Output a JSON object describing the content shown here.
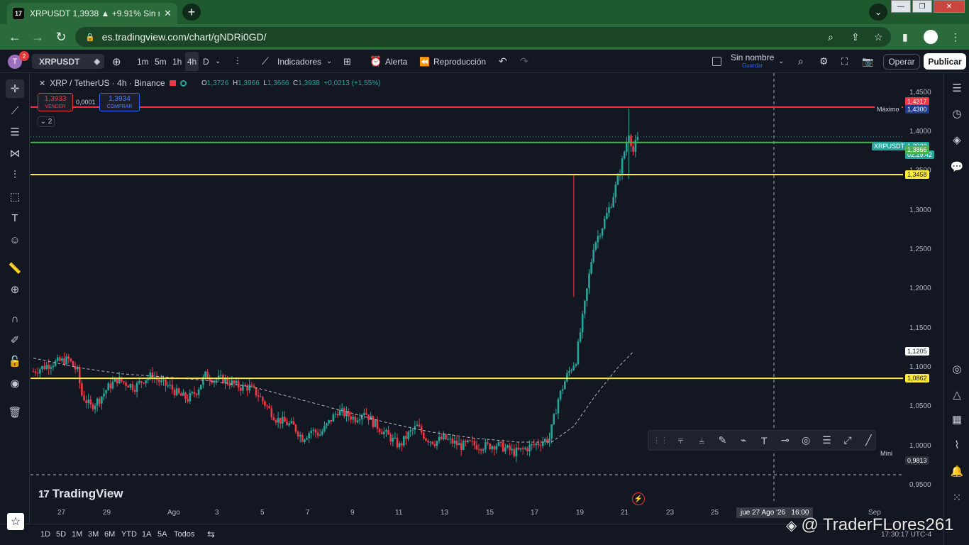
{
  "browser": {
    "tab_title": "XRPUSDT 1,3938 ▲ +9.91% Sin n",
    "tab_favicon": "17",
    "url": "es.tradingview.com/chart/gNDRi0GD/"
  },
  "toolbar": {
    "avatar_letter": "T",
    "notification_count": "2",
    "symbol": "XRPUSDT",
    "timeframes": [
      "1m",
      "5m",
      "1h",
      "4h",
      "D"
    ],
    "active_timeframe": "4h",
    "indicators_label": "Indicadores",
    "alert_label": "Alerta",
    "replay_label": "Reproducción",
    "layout_name": "Sin nombre",
    "save_label": "Guardar",
    "trade_label": "Operar",
    "publish_label": "Publicar"
  },
  "legend": {
    "title": "XRP / TetherUS · 4h · Binance",
    "o_label": "O",
    "o": "1,3726",
    "h_label": "H",
    "h": "1,3966",
    "l_label": "L",
    "l": "1,3666",
    "c_label": "C",
    "c": "1,3938",
    "change": "+0,0213 (+1,55%)",
    "sell_price": "1,3933",
    "sell_label": "VENDER",
    "spread": "0,0001",
    "buy_price": "1,3934",
    "buy_label": "COMPRAR",
    "collapsed_count": "2"
  },
  "brand": {
    "logo_text": "TradingView",
    "watermark": "@ TraderFLores261"
  },
  "price_axis": {
    "ticks": [
      "1,4500",
      "1,4000",
      "1,3500",
      "1,3000",
      "1,2500",
      "1,2000",
      "1,1500",
      "1,1000",
      "1,0500",
      "1,0000",
      "0,9500"
    ],
    "badges": {
      "max_label": "Máximo",
      "max_value": "1,4300",
      "red_line": "1,4317",
      "symbol_label": "XRPUSDT",
      "last_price": "1,3938",
      "countdown": "02:29:42",
      "green_line": "1,3866",
      "yellow_top": "1,3458",
      "ma_value": "1,1205",
      "yellow_bottom": "1,0862",
      "min_label": "Míni",
      "min_value": "0,9813"
    }
  },
  "time_axis": {
    "ticks": [
      "27",
      "29",
      "Ago",
      "3",
      "5",
      "7",
      "9",
      "11",
      "13",
      "15",
      "17",
      "19",
      "21",
      "23",
      "25",
      "Sep"
    ],
    "crosshair_label": "jue 27 Ago '26   16:00"
  },
  "ranges": [
    "1D",
    "5D",
    "1M",
    "3M",
    "6M",
    "YTD",
    "1A",
    "5A",
    "Todos"
  ],
  "clock": "17:30:17 UTC-4",
  "chart_data": {
    "type": "candlestick",
    "title": "XRP / TetherUS · 4h · Binance",
    "y_range": [
      0.93,
      1.475
    ],
    "horizontal_lines": [
      {
        "name": "red",
        "value": 1.4317,
        "color": "#f23645"
      },
      {
        "name": "green",
        "value": 1.3866,
        "color": "#4caf50"
      },
      {
        "name": "yellow",
        "value": 1.3458,
        "color": "#ffeb3b"
      },
      {
        "name": "yellow",
        "value": 1.0862,
        "color": "#ffeb3b"
      }
    ],
    "close_path": [
      [
        0,
        1.095
      ],
      [
        4,
        1.1
      ],
      [
        8,
        1.105
      ],
      [
        12,
        1.108
      ],
      [
        16,
        1.11
      ],
      [
        20,
        1.095
      ],
      [
        22,
        1.065
      ],
      [
        26,
        1.05
      ],
      [
        30,
        1.06
      ],
      [
        34,
        1.075
      ],
      [
        38,
        1.085
      ],
      [
        42,
        1.08
      ],
      [
        46,
        1.075
      ],
      [
        50,
        1.085
      ],
      [
        54,
        1.09
      ],
      [
        58,
        1.08
      ],
      [
        62,
        1.075
      ],
      [
        66,
        1.065
      ],
      [
        70,
        1.06
      ],
      [
        74,
        1.07
      ],
      [
        78,
        1.09
      ],
      [
        82,
        1.085
      ],
      [
        86,
        1.085
      ],
      [
        90,
        1.08
      ],
      [
        94,
        1.075
      ],
      [
        98,
        1.075
      ],
      [
        102,
        1.065
      ],
      [
        106,
        1.05
      ],
      [
        110,
        1.035
      ],
      [
        114,
        1.03
      ],
      [
        118,
        1.025
      ],
      [
        122,
        1.01
      ],
      [
        126,
        1.02
      ],
      [
        130,
        1.015
      ],
      [
        134,
        1.03
      ],
      [
        138,
        1.045
      ],
      [
        142,
        1.04
      ],
      [
        146,
        1.035
      ],
      [
        150,
        1.045
      ],
      [
        154,
        1.03
      ],
      [
        158,
        1.02
      ],
      [
        162,
        1.01
      ],
      [
        166,
        1.0
      ],
      [
        170,
        1.015
      ],
      [
        174,
        1.025
      ],
      [
        178,
        1.01
      ],
      [
        182,
        1.005
      ],
      [
        186,
        1.01
      ],
      [
        190,
        1.005
      ],
      [
        194,
        1.0
      ],
      [
        198,
        1.003
      ],
      [
        202,
        1.0
      ],
      [
        206,
        1.0
      ],
      [
        210,
        1.002
      ],
      [
        214,
        0.997
      ],
      [
        218,
        0.992
      ],
      [
        222,
        0.995
      ],
      [
        226,
        1.0
      ],
      [
        230,
        1.005
      ],
      [
        234,
        1.01
      ],
      [
        238,
        1.06
      ],
      [
        242,
        1.09
      ],
      [
        246,
        1.11
      ],
      [
        250,
        1.18
      ],
      [
        254,
        1.255
      ],
      [
        258,
        1.28
      ],
      [
        262,
        1.31
      ],
      [
        266,
        1.35
      ],
      [
        270,
        1.4
      ],
      [
        272,
        1.375
      ],
      [
        274,
        1.394
      ]
    ],
    "moving_average": [
      [
        0,
        1.112
      ],
      [
        20,
        1.1
      ],
      [
        40,
        1.092
      ],
      [
        60,
        1.088
      ],
      [
        80,
        1.083
      ],
      [
        100,
        1.075
      ],
      [
        120,
        1.06
      ],
      [
        140,
        1.045
      ],
      [
        160,
        1.03
      ],
      [
        180,
        1.018
      ],
      [
        200,
        1.01
      ],
      [
        220,
        1.005
      ],
      [
        235,
        1.005
      ],
      [
        245,
        1.025
      ],
      [
        255,
        1.065
      ],
      [
        265,
        1.1
      ],
      [
        272,
        1.12
      ]
    ],
    "last_price": 1.3938,
    "high": 1.43,
    "low": 0.9813
  },
  "colors": {
    "up": "#26a69a",
    "down": "#f23645",
    "background": "#131722"
  },
  "left_tools": [
    "crosshair-icon",
    "trend-line-icon",
    "fib-icon",
    "pattern-icon",
    "forecast-icon",
    "geometric-icon",
    "text-icon",
    "emoji-icon",
    "ruler-icon",
    "zoom-icon",
    "magnet-icon",
    "lock-draw-icon",
    "lock-icon",
    "eye-icon",
    "trash-icon"
  ],
  "right_tools": [
    "watchlist-icon",
    "clock-icon",
    "layers-icon",
    "chat-icon",
    "target-icon",
    "ideas-icon",
    "calendar-icon",
    "broadcast-icon",
    "bell-icon",
    "apps-icon"
  ]
}
